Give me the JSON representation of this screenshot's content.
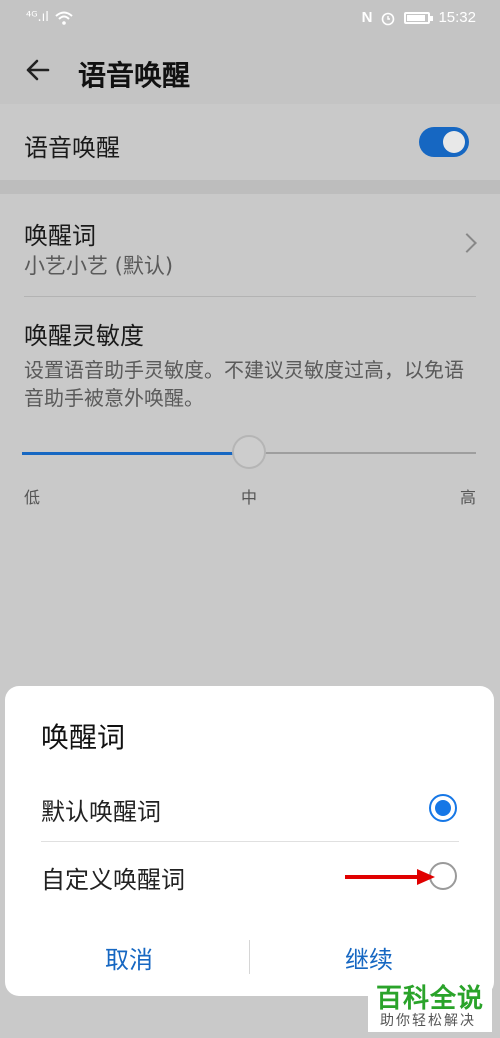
{
  "status_bar": {
    "left": "⁴ᴳ.ıl",
    "time": "15:32",
    "nfc": "N"
  },
  "header": {
    "title": "语音唤醒"
  },
  "voice_wake": {
    "label": "语音唤醒",
    "enabled": true
  },
  "wake_word": {
    "title": "唤醒词",
    "value": "小艺小艺 (默认)"
  },
  "sensitivity": {
    "title": "唤醒灵敏度",
    "description": "设置语音助手灵敏度。不建议灵敏度过高，以免语音助手被意外唤醒。",
    "level": 0.5,
    "low": "低",
    "mid": "中",
    "high": "高"
  },
  "dialog": {
    "title": "唤醒词",
    "options": [
      {
        "label": "默认唤醒词",
        "selected": true
      },
      {
        "label": "自定义唤醒词",
        "selected": false
      }
    ],
    "cancel": "取消",
    "continue": "继续"
  },
  "watermark": {
    "brand": "百科全说",
    "slogan": "助你轻松解决"
  },
  "colors": {
    "accent": "#1667c2",
    "annotation_arrow": "#e00000",
    "brand_green": "#2aa32a"
  }
}
